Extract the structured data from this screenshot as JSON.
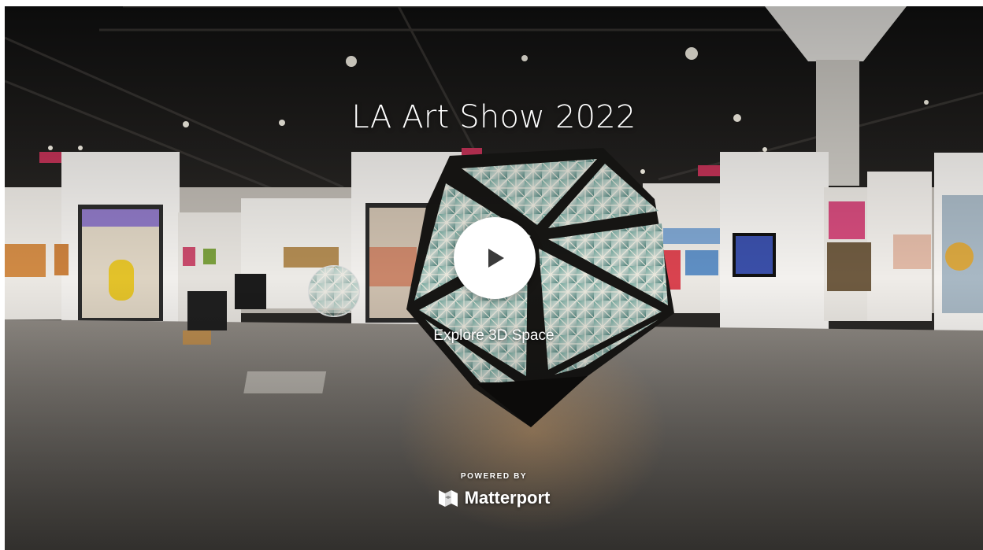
{
  "tour": {
    "title": "LA Art Show 2022",
    "explore_label": "Explore 3D Space",
    "powered_by": "POWERED BY",
    "brand_name": "Matterport"
  },
  "icons": {
    "play": "play-icon",
    "brand_logo": "matterport-logo-icon"
  },
  "colors": {
    "overlay_text": "#ffffff",
    "play_button_bg": "#ffffff",
    "play_glyph": "#3a3a3a"
  }
}
